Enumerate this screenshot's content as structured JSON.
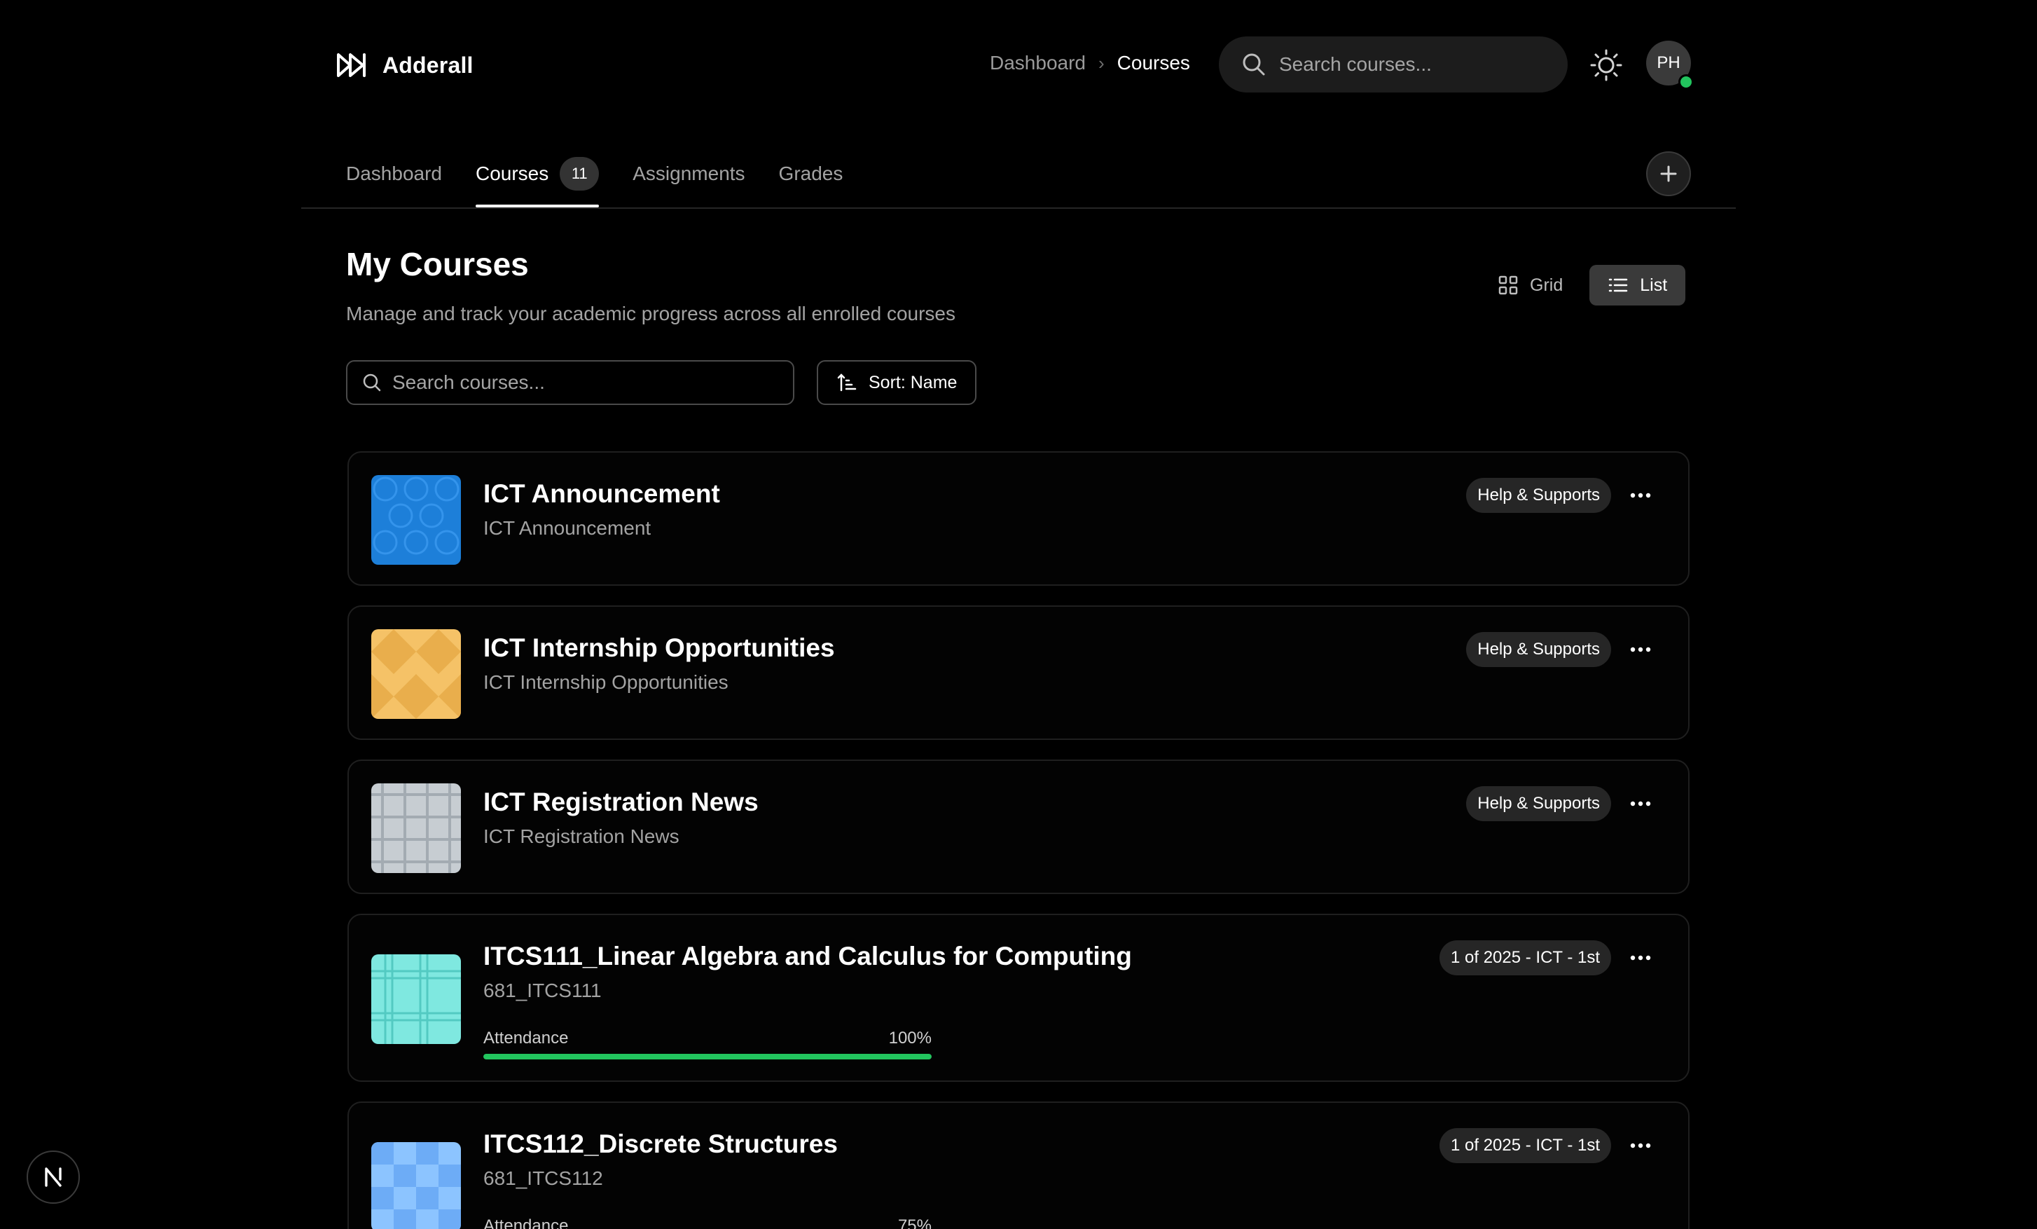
{
  "app": {
    "name": "Adderall"
  },
  "breadcrumb": {
    "items": [
      "Dashboard",
      "Courses"
    ]
  },
  "top_search": {
    "placeholder": "Search courses..."
  },
  "user": {
    "initials": "PH",
    "status_color": "#22c55e"
  },
  "tabs": [
    {
      "label": "Dashboard"
    },
    {
      "label": "Courses",
      "badge": "11",
      "active": true
    },
    {
      "label": "Assignments"
    },
    {
      "label": "Grades"
    }
  ],
  "page": {
    "title": "My Courses",
    "subtitle": "Manage and track your academic progress across all enrolled courses"
  },
  "view_toggle": {
    "grid_label": "Grid",
    "list_label": "List",
    "selected": "List"
  },
  "filter": {
    "search_placeholder": "Search courses...",
    "sort_label": "Sort: Name"
  },
  "courses": [
    {
      "title": "ICT Announcement",
      "subtitle": "ICT Announcement",
      "tag": "Help & Supports",
      "thumb": "blue-bubbles"
    },
    {
      "title": "ICT Internship Opportunities",
      "subtitle": "ICT Internship Opportunities",
      "tag": "Help & Supports",
      "thumb": "orange-diamonds"
    },
    {
      "title": "ICT Registration News",
      "subtitle": "ICT Registration News",
      "tag": "Help & Supports",
      "thumb": "gray-plaid"
    },
    {
      "title": "ITCS111_Linear Algebra and Calculus for Computing",
      "subtitle": "681_ITCS111",
      "tag": "1 of 2025 - ICT - 1st",
      "attendance_label": "Attendance",
      "attendance_pct": "100%",
      "attendance_value": 1.0,
      "thumb": "teal-plaid"
    },
    {
      "title": "ITCS112_Discrete Structures",
      "subtitle": "681_ITCS112",
      "tag": "1 of 2025 - ICT - 1st",
      "attendance_label": "Attendance",
      "attendance_pct": "75%",
      "attendance_value": 0.75,
      "thumb": "blue-squares"
    }
  ],
  "colors": {
    "accent_green": "#22c55e",
    "background": "#000000"
  }
}
